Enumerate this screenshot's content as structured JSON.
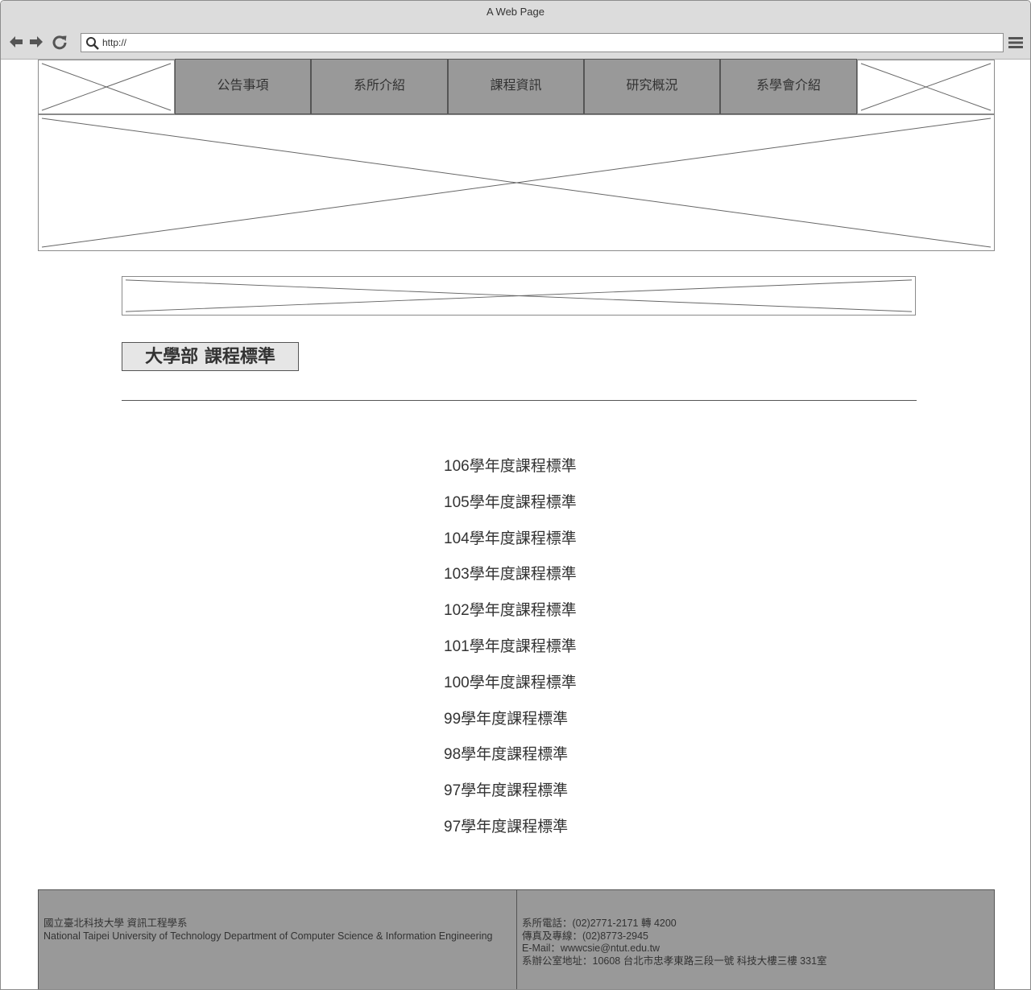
{
  "window": {
    "title": "A Web Page"
  },
  "browser": {
    "url": "http://"
  },
  "nav": {
    "tabs": [
      {
        "label": "公告事項"
      },
      {
        "label": "系所介紹"
      },
      {
        "label": "課程資訊"
      },
      {
        "label": "研究概況"
      },
      {
        "label": "系學會介紹"
      }
    ]
  },
  "main": {
    "section_title": "大學部 課程標準",
    "courses": [
      {
        "year": "106",
        "text": "學年度課程標準"
      },
      {
        "year": "105",
        "text": "學年度課程標準"
      },
      {
        "year": "104",
        "text": "學年度課程標準"
      },
      {
        "year": "103",
        "text": "學年度課程標準"
      },
      {
        "year": "102",
        "text": "學年度課程標準"
      },
      {
        "year": "101",
        "text": "學年度課程標準"
      },
      {
        "year": "100",
        "text": "學年度課程標準"
      },
      {
        "year": "99",
        "text": "學年度課程標準"
      },
      {
        "year": "98",
        "text": "學年度課程標準"
      },
      {
        "year": "97",
        "text": "學年度課程標準"
      },
      {
        "year": "97",
        "text": "學年度課程標準"
      }
    ]
  },
  "footer": {
    "left": {
      "line1": "國立臺北科技大學 資訊工程學系",
      "line2": "National Taipei University of Technology Department of Computer Science & Information Engineering"
    },
    "right": {
      "phone": "系所電話：(02)2771-2171 轉 4200",
      "fax": "傳真及專線：(02)8773-2945",
      "email": "E-Mail：wwwcsie@ntut.edu.tw",
      "address": "系辦公室地址：10608 台北市忠孝東路三段一號 科技大樓三樓 331室"
    }
  }
}
